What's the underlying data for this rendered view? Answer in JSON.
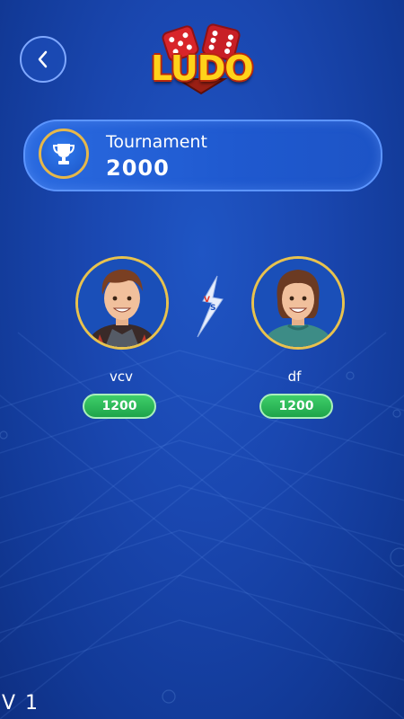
{
  "logo": {
    "text": "LUDO"
  },
  "tournament": {
    "label": "Tournament",
    "value": "2000"
  },
  "players": [
    {
      "name": "vcv",
      "score": "1200"
    },
    {
      "name": "df",
      "score": "1200"
    }
  ],
  "version": "V 1",
  "icons": {
    "back": "chevron-left-icon",
    "trophy": "trophy-icon",
    "versus": "vs-lightning-icon",
    "dice": "dice-icon"
  },
  "colors": {
    "background": "#1a47b0",
    "accent_border": "#5c95ff",
    "gold": "#e8c24e",
    "pill_green": "#1ea44a"
  }
}
